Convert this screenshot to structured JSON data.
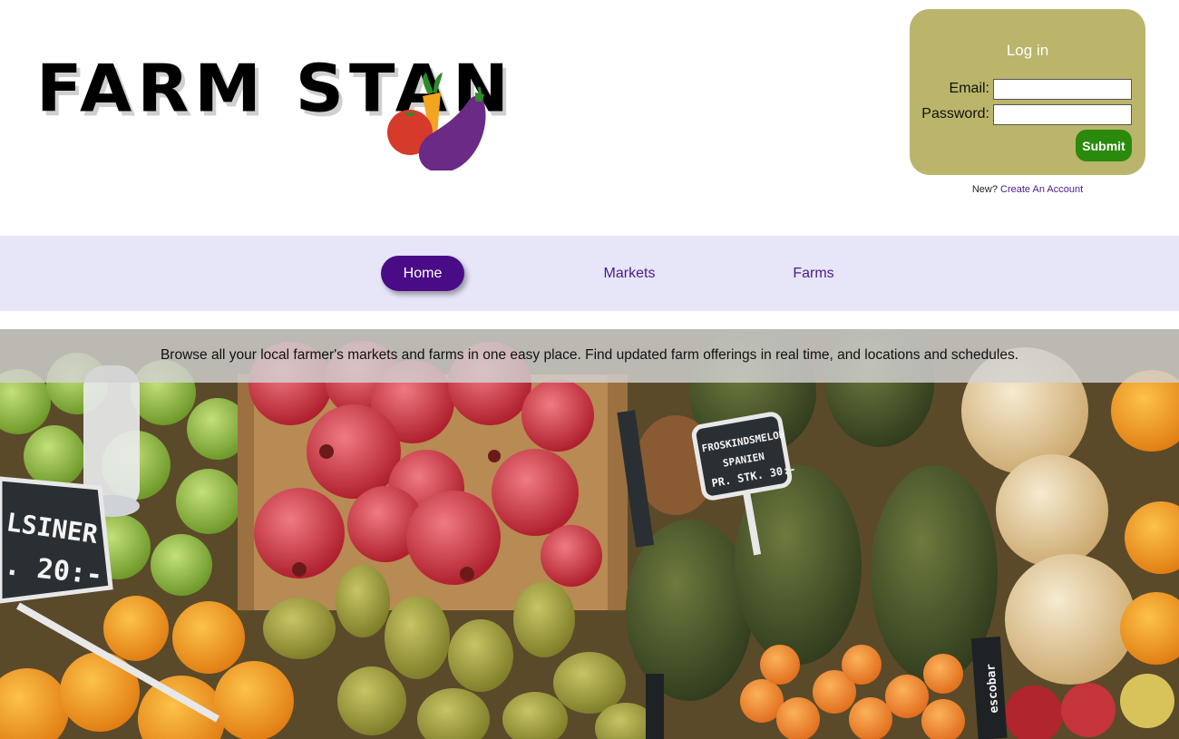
{
  "logo": {
    "text": "FARM STAN"
  },
  "login": {
    "title": "Log in",
    "email_label": "Email:",
    "email_value": "",
    "password_label": "Password:",
    "password_value": "",
    "submit_label": "Submit",
    "new_prefix": "New?",
    "create_account_label": "Create An Account"
  },
  "nav": {
    "items": [
      {
        "label": "Home",
        "active": true
      },
      {
        "label": "Markets",
        "active": false
      },
      {
        "label": "Farms",
        "active": false
      }
    ]
  },
  "hero": {
    "tagline": "Browse all your local farmer's markets and farms in one easy place. Find updated farm offerings in real time, and locations and schedules.",
    "signs": {
      "left_line1": "LSINER",
      "left_line2": ". 20:-",
      "melon_line1": "FROSKINDSMELON",
      "melon_line2": "SPANIEN",
      "melon_line3": "PR. STK.   30:-",
      "crate_label": "escobar"
    }
  },
  "colors": {
    "login_bg": "#bab56a",
    "submit_bg": "#2a8a0c",
    "nav_bg": "#e6e6f8",
    "nav_active_bg": "#4a0c86",
    "link_purple": "#4b1a8c"
  }
}
